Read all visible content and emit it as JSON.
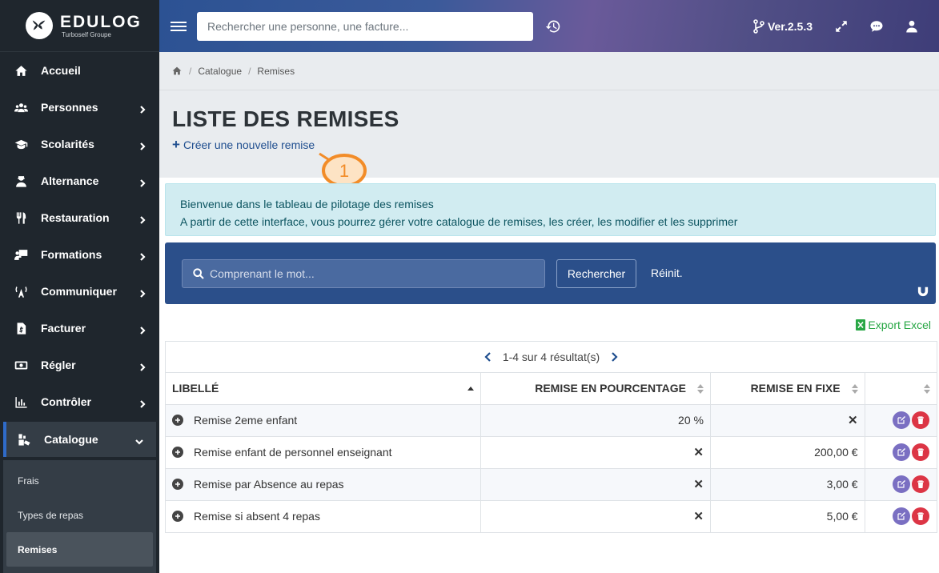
{
  "brand": {
    "name": "EDULOG",
    "sub": "Turboself Groupe"
  },
  "sidebar": {
    "items": [
      {
        "label": "Accueil",
        "icon": "home-icon",
        "chevron": false
      },
      {
        "label": "Personnes",
        "icon": "users-icon",
        "chevron": true
      },
      {
        "label": "Scolarités",
        "icon": "graduation-cap-icon",
        "chevron": true
      },
      {
        "label": "Alternance",
        "icon": "user-tie-icon",
        "chevron": true
      },
      {
        "label": "Restauration",
        "icon": "utensils-icon",
        "chevron": true
      },
      {
        "label": "Formations",
        "icon": "chalkboard-icon",
        "chevron": true
      },
      {
        "label": "Communiquer",
        "icon": "broadcast-icon",
        "chevron": true
      },
      {
        "label": "Facturer",
        "icon": "invoice-icon",
        "chevron": true
      },
      {
        "label": "Régler",
        "icon": "money-bill-icon",
        "chevron": true
      },
      {
        "label": "Contrôler",
        "icon": "chart-icon",
        "chevron": true
      },
      {
        "label": "Catalogue",
        "icon": "catalogue-icon",
        "chevron": true,
        "active": true
      }
    ],
    "subitems": [
      {
        "label": "Frais"
      },
      {
        "label": "Types de repas"
      },
      {
        "label": "Remises",
        "active": true
      }
    ]
  },
  "topbar": {
    "search_placeholder": "Rechercher une personne, une facture...",
    "version": "Ver.2.5.3"
  },
  "breadcrumb": {
    "items": [
      "Catalogue",
      "Remises"
    ]
  },
  "page": {
    "title": "LISTE DES REMISES",
    "create_label": "Créer une nouvelle remise",
    "callout_number": "1"
  },
  "info": {
    "line1": "Bienvenue dans le tableau de pilotage des remises",
    "line2": "A partir de cette interface, vous pourrez gérer votre catalogue de remises, les créer, les modifier et les supprimer"
  },
  "filter": {
    "placeholder": "Comprenant le mot...",
    "search_label": "Rechercher",
    "reset_label": "Réinit."
  },
  "export_label": "Export Excel",
  "table": {
    "pager": "1-4 sur 4 résultat(s)",
    "headers": [
      "LIBELLÉ",
      "REMISE EN POURCENTAGE",
      "REMISE EN FIXE"
    ],
    "rows": [
      {
        "label": "Remise 2eme enfant",
        "pct": "20 %",
        "fixe": "✕"
      },
      {
        "label": "Remise enfant de personnel enseignant",
        "pct": "✕",
        "fixe": "200,00 €"
      },
      {
        "label": "Remise par Absence au repas",
        "pct": "✕",
        "fixe": "3,00 €"
      },
      {
        "label": "Remise si absent 4 repas",
        "pct": "✕",
        "fixe": "5,00 €"
      }
    ]
  },
  "colors": {
    "sidebar_bg": "#1f262d",
    "accent": "#2f6bc9",
    "filter_bg": "#2b4f8a",
    "info_bg": "#d1ecf1",
    "success": "#28a745",
    "danger": "#dc3545",
    "edit": "#7a6fc2",
    "callout": "#f28c28"
  }
}
